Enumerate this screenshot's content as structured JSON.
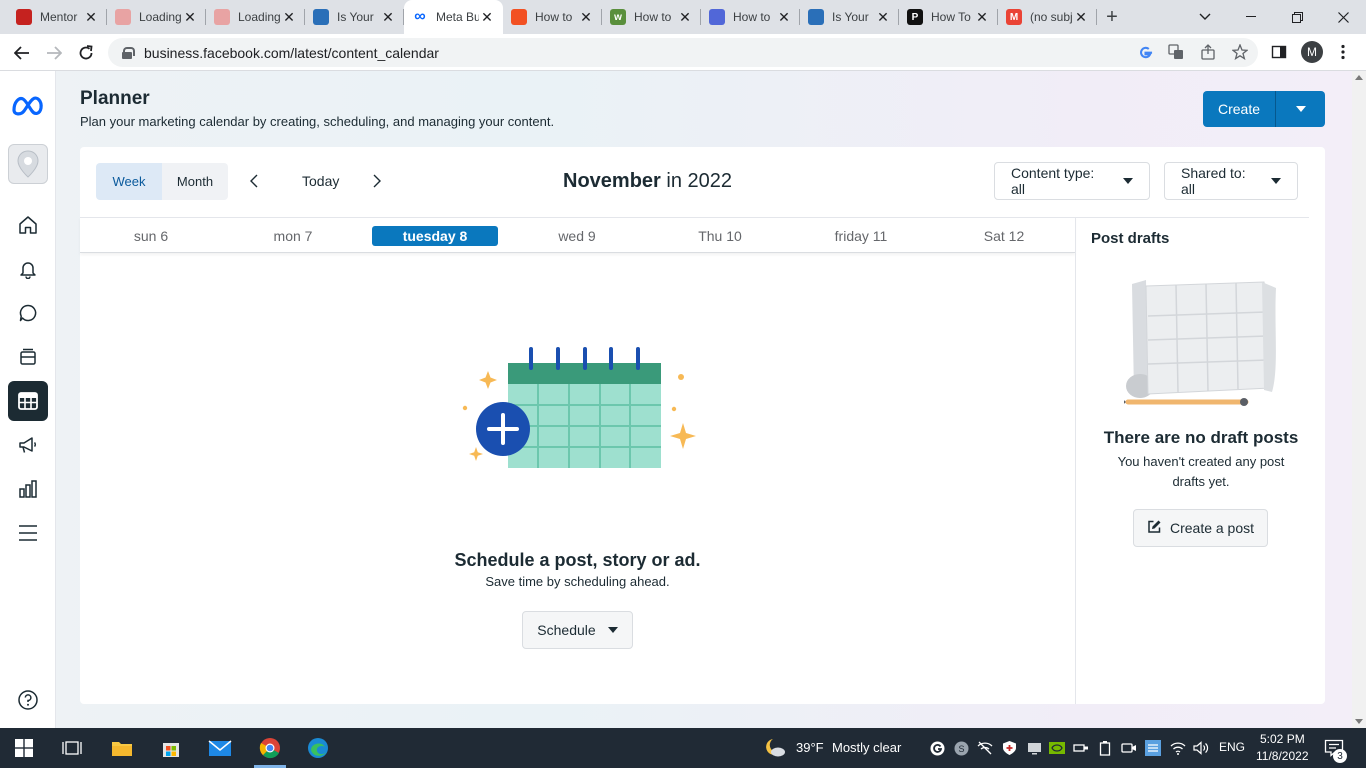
{
  "browser": {
    "tabs": [
      {
        "title": "Mentor",
        "favicon_color": "#c5221f",
        "favicon_text": ""
      },
      {
        "title": "Loading",
        "favicon_color": "#e8a3a3",
        "favicon_text": ""
      },
      {
        "title": "Loading",
        "favicon_color": "#e8a3a3",
        "favicon_text": ""
      },
      {
        "title": "Is Your",
        "favicon_color": "#2a6fb8",
        "favicon_text": ""
      },
      {
        "title": "Meta Business",
        "favicon_color": "#0866ff",
        "favicon_text": "∞"
      },
      {
        "title": "How to",
        "favicon_color": "#f25022",
        "favicon_text": ""
      },
      {
        "title": "How to",
        "favicon_color": "#5a8f3c",
        "favicon_text": "w"
      },
      {
        "title": "How to",
        "favicon_color": "#5167d8",
        "favicon_text": ""
      },
      {
        "title": "Is Your",
        "favicon_color": "#2a6fb8",
        "favicon_text": ""
      },
      {
        "title": "How To",
        "favicon_color": "#111111",
        "favicon_text": "P"
      },
      {
        "title": "(no subject)",
        "favicon_color": "#ea4335",
        "favicon_text": "M"
      }
    ],
    "url": "business.facebook.com/latest/content_calendar",
    "profile_initial": "M"
  },
  "header": {
    "title": "Planner",
    "subtitle": "Plan your marketing calendar by creating, scheduling, and managing your content.",
    "create_label": "Create"
  },
  "toolbar": {
    "week_label": "Week",
    "month_label": "Month",
    "today_label": "Today",
    "month_name": "November",
    "year_text": "in 2022",
    "content_type_label": "Content type: all",
    "shared_to_label": "Shared to: all"
  },
  "week_days": [
    {
      "label": "sun 6",
      "is_today": false
    },
    {
      "label": "mon 7",
      "is_today": false
    },
    {
      "label": "tuesday 8",
      "is_today": true
    },
    {
      "label": "wed 9",
      "is_today": false
    },
    {
      "label": "Thu 10",
      "is_today": false
    },
    {
      "label": "friday 11",
      "is_today": false
    },
    {
      "label": "Sat 12",
      "is_today": false
    }
  ],
  "empty_state": {
    "title": "Schedule a post, story or ad.",
    "subtitle": "Save time by scheduling ahead.",
    "schedule_label": "Schedule"
  },
  "drafts": {
    "title": "Post drafts",
    "empty_title": "There are no draft posts",
    "empty_subtitle": "You haven't created any post drafts yet.",
    "create_post_label": "Create a post"
  },
  "taskbar": {
    "weather_temp": "39°F",
    "weather_text": "Mostly clear",
    "language": "ENG",
    "time": "5:02 PM",
    "date": "11/8/2022",
    "notification_count": "3"
  },
  "colors": {
    "accent": "#0a78be",
    "calendar_header": "#3a9a7a",
    "calendar_body": "#9ee0cf",
    "plus_circle": "#1a4fb0",
    "sparkle": "#f7b955"
  }
}
